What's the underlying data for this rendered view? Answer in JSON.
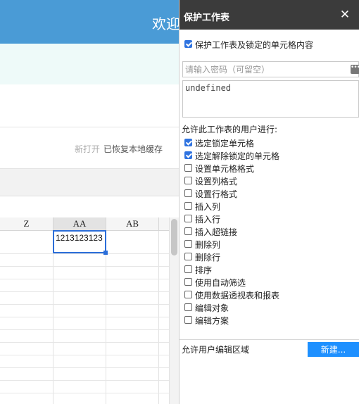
{
  "app": {
    "welcome_text": "欢迎",
    "status_new": "新打开",
    "status_restored": "已恢复本地缓存"
  },
  "sheet": {
    "columns": [
      "Z",
      "AA",
      "AB"
    ],
    "selected_column": "AA",
    "active_cell_value": "1213123123"
  },
  "panel": {
    "title": "保护工作表",
    "close_icon": "close-icon",
    "protect_label": "保护工作表及锁定的单元格内容",
    "protect_checked": true,
    "password_placeholder": "请输入密码（可留空）",
    "password_value": "",
    "confirm_value": "undefined",
    "allow_heading": "允许此工作表的用户进行:",
    "permissions": [
      {
        "label": "选定锁定单元格",
        "checked": true
      },
      {
        "label": "选定解除锁定的单元格",
        "checked": true
      },
      {
        "label": "设置单元格格式",
        "checked": false
      },
      {
        "label": "设置列格式",
        "checked": false
      },
      {
        "label": "设置行格式",
        "checked": false
      },
      {
        "label": "插入列",
        "checked": false
      },
      {
        "label": "插入行",
        "checked": false
      },
      {
        "label": "插入超链接",
        "checked": false
      },
      {
        "label": "删除列",
        "checked": false
      },
      {
        "label": "删除行",
        "checked": false
      },
      {
        "label": "排序",
        "checked": false
      },
      {
        "label": "使用自动筛选",
        "checked": false
      },
      {
        "label": "使用数据透视表和报表",
        "checked": false
      },
      {
        "label": "编辑对象",
        "checked": false
      },
      {
        "label": "编辑方案",
        "checked": false
      }
    ],
    "allow_range_label": "允许用户编辑区域",
    "new_button_label": "新建..."
  },
  "colors": {
    "topbar": "#4a9bd6",
    "panel_header": "#3b3b3b",
    "accent_button": "#1e90ff",
    "checkbox_checked": "#2f73e0",
    "selection_border": "#2b6ed9"
  }
}
